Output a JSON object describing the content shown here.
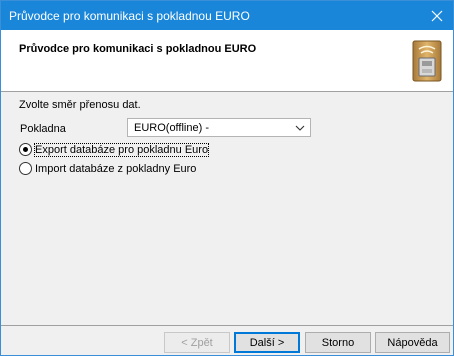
{
  "window": {
    "title": "Průvodce pro komunikaci s pokladnou EURO",
    "close_glyph": "✕"
  },
  "header": {
    "heading": "Průvodce pro komunikaci s pokladnou EURO",
    "icon": "cash-register-icon"
  },
  "form": {
    "prompt": "Zvolte směr přenosu dat.",
    "pokladna_label": "Pokladna",
    "pokladna_value": "EURO(offline) -",
    "options": [
      {
        "label": "Export databáze pro pokladnu Euro",
        "checked": true
      },
      {
        "label": "Import databáze z pokladny Euro",
        "checked": false
      }
    ]
  },
  "buttons": {
    "back": "< Zpět",
    "next": "Další >",
    "cancel": "Storno",
    "help": "Nápověda"
  },
  "colors": {
    "titlebar": "#1a86d9",
    "default_button_border": "#0078d7"
  }
}
